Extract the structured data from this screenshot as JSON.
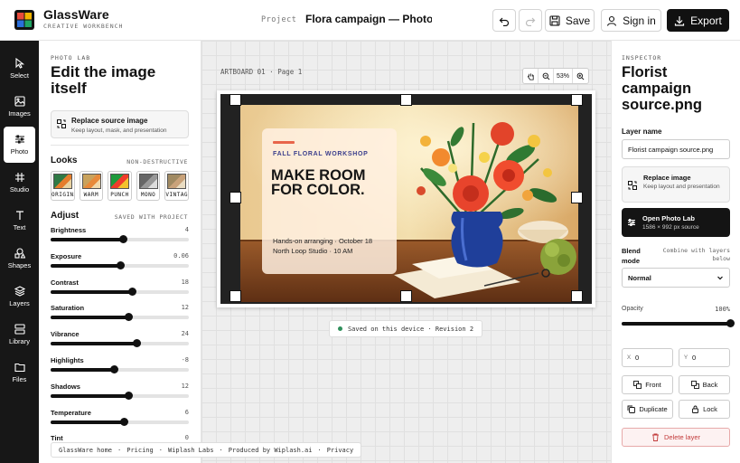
{
  "app": {
    "name": "GlassWare",
    "subtitle": "CREATIVE WORKBENCH",
    "logo_colors": [
      "#e94b3c",
      "#f4b400",
      "#2a6fdb",
      "#1fa463"
    ]
  },
  "header": {
    "project_label": "Project",
    "project_title": "Flora campaign — Photo La",
    "undo_icon": "undo-icon",
    "redo_icon": "redo-icon",
    "save_label": "Save",
    "signin_label": "Sign in",
    "export_label": "Export"
  },
  "rail": {
    "items": [
      {
        "label": "Select",
        "icon": "cursor-icon",
        "active": false
      },
      {
        "label": "Images",
        "icon": "image-icon",
        "active": false
      },
      {
        "label": "Photo",
        "icon": "sliders-icon",
        "active": true
      },
      {
        "label": "Studio",
        "icon": "grid-icon",
        "active": false
      },
      {
        "label": "Text",
        "icon": "text-icon",
        "active": false
      },
      {
        "label": "Shapes",
        "icon": "shapes-icon",
        "active": false
      },
      {
        "label": "Layers",
        "icon": "layers-icon",
        "active": false
      },
      {
        "label": "Library",
        "icon": "library-icon",
        "active": false
      },
      {
        "label": "Files",
        "icon": "folder-icon",
        "active": false
      }
    ]
  },
  "left_panel": {
    "eyebrow": "PHOTO LAB",
    "title": "Edit the image itself",
    "replace": {
      "title": "Replace source image",
      "subtitle": "Keep layout, mask, and presentation"
    },
    "looks": {
      "title": "Looks",
      "note": "NON-DESTRUCTIVE",
      "items": [
        {
          "label": "ORIGINAL"
        },
        {
          "label": "WARM"
        },
        {
          "label": "PUNCH"
        },
        {
          "label": "MONO"
        },
        {
          "label": "VINTAGE"
        }
      ]
    },
    "adjust": {
      "title": "Adjust",
      "note": "SAVED WITH PROJECT",
      "sliders": [
        {
          "name": "Brightness",
          "value": "4",
          "level": 0.52
        },
        {
          "name": "Exposure",
          "value": "0.06",
          "level": 0.5
        },
        {
          "name": "Contrast",
          "value": "18",
          "level": 0.59
        },
        {
          "name": "Saturation",
          "value": "12",
          "level": 0.56
        },
        {
          "name": "Vibrance",
          "value": "24",
          "level": 0.62
        },
        {
          "name": "Highlights",
          "value": "-8",
          "level": 0.46
        },
        {
          "name": "Shadows",
          "value": "12",
          "level": 0.56
        },
        {
          "name": "Temperature",
          "value": "6",
          "level": 0.53
        },
        {
          "name": "Tint",
          "value": "0",
          "level": 0.5
        }
      ]
    }
  },
  "canvas": {
    "artboard_label": "ARTBOARD 01 · Page 1",
    "zoom": "53%",
    "promo": {
      "eyebrow": "FALL FLORAL WORKSHOP",
      "headline_1": "MAKE ROOM",
      "headline_2": "FOR COLOR.",
      "line_1": "Hands-on arranging · October 18",
      "line_2": "North Loop Studio · 10 AM"
    },
    "saved_status": "Saved on this device · Revision 2"
  },
  "footer_links": [
    "GlassWare home",
    "Pricing",
    "Wiplash Labs",
    "Produced by Wiplash.ai",
    "Privacy"
  ],
  "footer_separator": "·",
  "inspector": {
    "eyebrow": "INSPECTOR",
    "title": "Florist campaign source.png",
    "layer_name_label": "Layer name",
    "layer_name_value": "Florist campaign source.png",
    "replace_image": {
      "title": "Replace image",
      "subtitle": "Keep layout and presentation"
    },
    "open_photo_lab": {
      "title": "Open Photo Lab",
      "subtitle": "1586 × 992 px source"
    },
    "blend_label": "Blend mode",
    "blend_note": "Combine with layers below",
    "blend_value": "Normal",
    "opacity_label": "Opacity",
    "opacity_value": "100%",
    "opacity_level": 1.0,
    "x_label": "X",
    "x_value": "0",
    "y_label": "Y",
    "y_value": "0",
    "front_label": "Front",
    "back_label": "Back",
    "duplicate_label": "Duplicate",
    "lock_label": "Lock",
    "delete_label": "Delete layer",
    "delete_color": "#c23b3b"
  }
}
